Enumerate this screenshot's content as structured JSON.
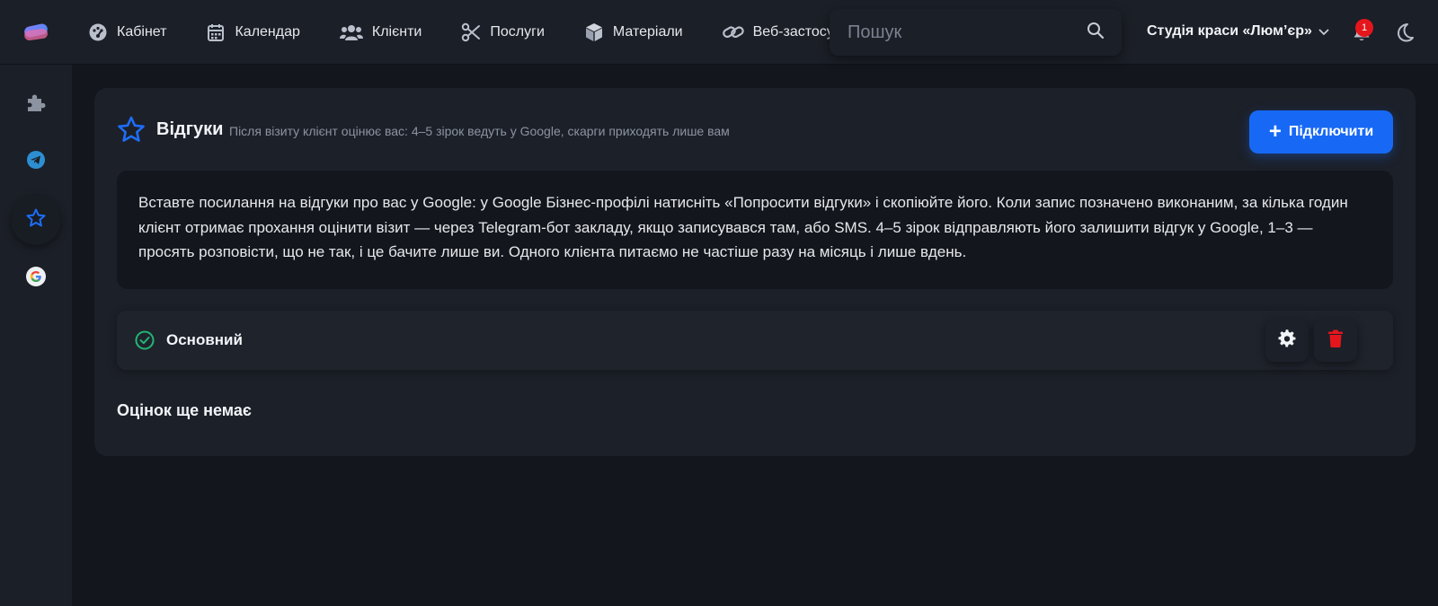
{
  "nav": {
    "items": [
      {
        "label": "Кабінет",
        "icon": "dashboard-icon"
      },
      {
        "label": "Календар",
        "icon": "calendar-icon"
      },
      {
        "label": "Клієнти",
        "icon": "users-icon"
      },
      {
        "label": "Послуги",
        "icon": "scissors-icon"
      },
      {
        "label": "Матеріали",
        "icon": "box-icon"
      },
      {
        "label": "Веб-застосунок",
        "icon": "link-icon"
      }
    ]
  },
  "search": {
    "placeholder": "Пошук"
  },
  "header": {
    "studio_name": "Студія краси «Люм’єр»",
    "notifications_count": "1"
  },
  "sidebar": {
    "items": [
      {
        "icon": "puzzle-icon",
        "active": false
      },
      {
        "icon": "telegram-icon",
        "active": false
      },
      {
        "icon": "star-icon",
        "active": true
      },
      {
        "icon": "google-icon",
        "active": false
      }
    ]
  },
  "reviews": {
    "title": "Відгуки",
    "subtitle": "Після візиту клієнт оцінює вас: 4–5 зірок ведуть у Google, скарги приходять лише вам",
    "connect_label": "Підключити",
    "info_text": "Вставте посилання на відгуки про вас у Google: у Google Бізнес-профілі натисніть «Попросити відгуки» і скопіюйте його. Коли запис позначено виконаним, за кілька годин клієнт отримає прохання оцінити візит — через Telegram-бот закладу, якщо записувався там, або SMS. 4–5 зірок відправляють його залишити відгук у Google, 1–3 — просять розповісти, що не так, і це бачите лише ви. Одного клієнта питаємо не частіше разу на місяць і лише вдень.",
    "integration": {
      "name": "Основний",
      "status": "active"
    },
    "empty_text": "Оцінок ще немає"
  },
  "colors": {
    "accent": "#1769f5",
    "danger": "#e5161b",
    "success": "#22b573",
    "background": "#13161c",
    "surface": "#1c2029"
  }
}
